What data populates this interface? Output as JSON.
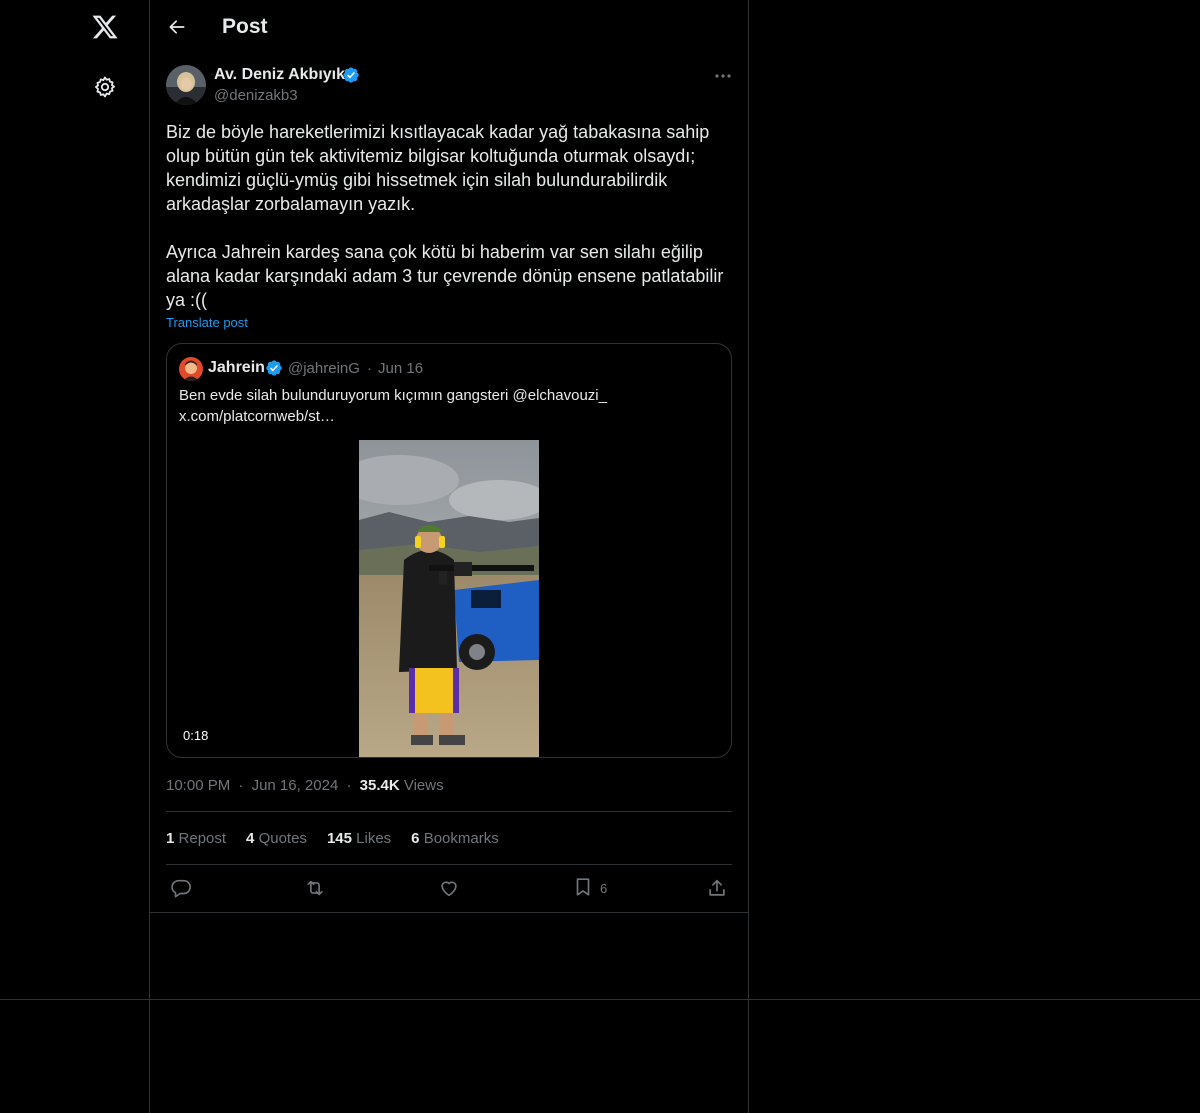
{
  "header": {
    "title": "Post",
    "back_icon": "arrow-left-icon"
  },
  "sidebar": {
    "logo_icon": "x-logo-icon",
    "settings_icon": "gear-icon"
  },
  "post": {
    "author_name": "Av. Deniz Akbıyık",
    "author_handle": "@denizakb3",
    "verified": true,
    "text": "Biz de böyle hareketlerimizi kısıtlayacak kadar yağ tabakasına sahip olup bütün gün tek aktivitemiz bilgisar koltuğunda oturmak olsaydı; kendimizi güçlü-ymüş gibi hissetmek için silah bulundurabilirdik arkadaşlar zorbalamayın yazık.\n\nAyrıca Jahrein kardeş sana çok kötü bi haberim var sen silahı eğilip alana kadar karşındaki adam 3 tur çevrende dönüp ensene patlatabilir ya :((",
    "translate_label": "Translate post",
    "time": "10:00 PM",
    "date": "Jun 16, 2024",
    "views_count": "35.4K",
    "views_label": "Views",
    "dot": "·"
  },
  "quote": {
    "author_name": "Jahrein",
    "author_handle": "@jahreinG",
    "dot": "·",
    "date": "Jun 16",
    "text": "Ben evde silah bulunduruyorum kıçımın gangsteri @elchavouzi_ x.com/platcornweb/st…",
    "video_duration": "0:18"
  },
  "stats": {
    "reposts_count": "1",
    "reposts_label": "Repost",
    "quotes_count": "4",
    "quotes_label": "Quotes",
    "likes_count": "145",
    "likes_label": "Likes",
    "bookmarks_count": "6",
    "bookmarks_label": "Bookmarks"
  },
  "actions": {
    "reply_icon": "reply-icon",
    "repost_icon": "repost-icon",
    "like_icon": "heart-icon",
    "bookmark_icon": "bookmark-icon",
    "bookmark_count": "6",
    "share_icon": "share-icon"
  },
  "colors": {
    "background": "#000000",
    "text": "#e7e9ea",
    "secondary": "#71767b",
    "accent": "#1d9bf0",
    "border": "#2f3336"
  }
}
